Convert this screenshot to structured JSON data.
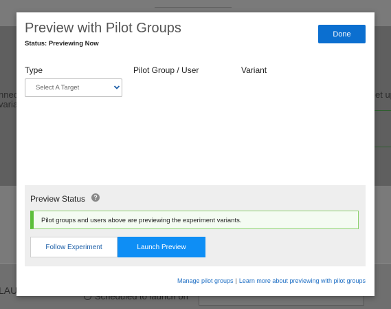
{
  "background": {
    "left_fragments": [
      "nnect",
      "varia"
    ],
    "right_fragment": "et up",
    "green_fragment": "g",
    "bottom_left_fragment": "LAU",
    "scheduled_label": "Scheduled to launch on"
  },
  "modal": {
    "title": "Preview with Pilot Groups",
    "status_label": "Status:",
    "status_value": "Previewing Now",
    "done_label": "Done",
    "columns": [
      "Type",
      "Pilot Group / User",
      "Variant"
    ],
    "type_select": {
      "placeholder": "Select A Target"
    }
  },
  "preview_status": {
    "title": "Preview Status",
    "help_glyph": "?",
    "banner": "Pilot groups and users above are previewing the experiment variants.",
    "follow_label": "Follow Experiment",
    "launch_label": "Launch Preview"
  },
  "footer": {
    "manage_link": "Manage pilot groups",
    "separator": "|",
    "learn_link": "Learn more about previewing with pilot groups"
  },
  "colors": {
    "primary": "#0b6fd0",
    "launch": "#0e8ef5",
    "success_border": "#5cbf3a",
    "link": "#1f6fc4"
  },
  "icons": [
    "chevron-down-icon",
    "help-icon"
  ]
}
